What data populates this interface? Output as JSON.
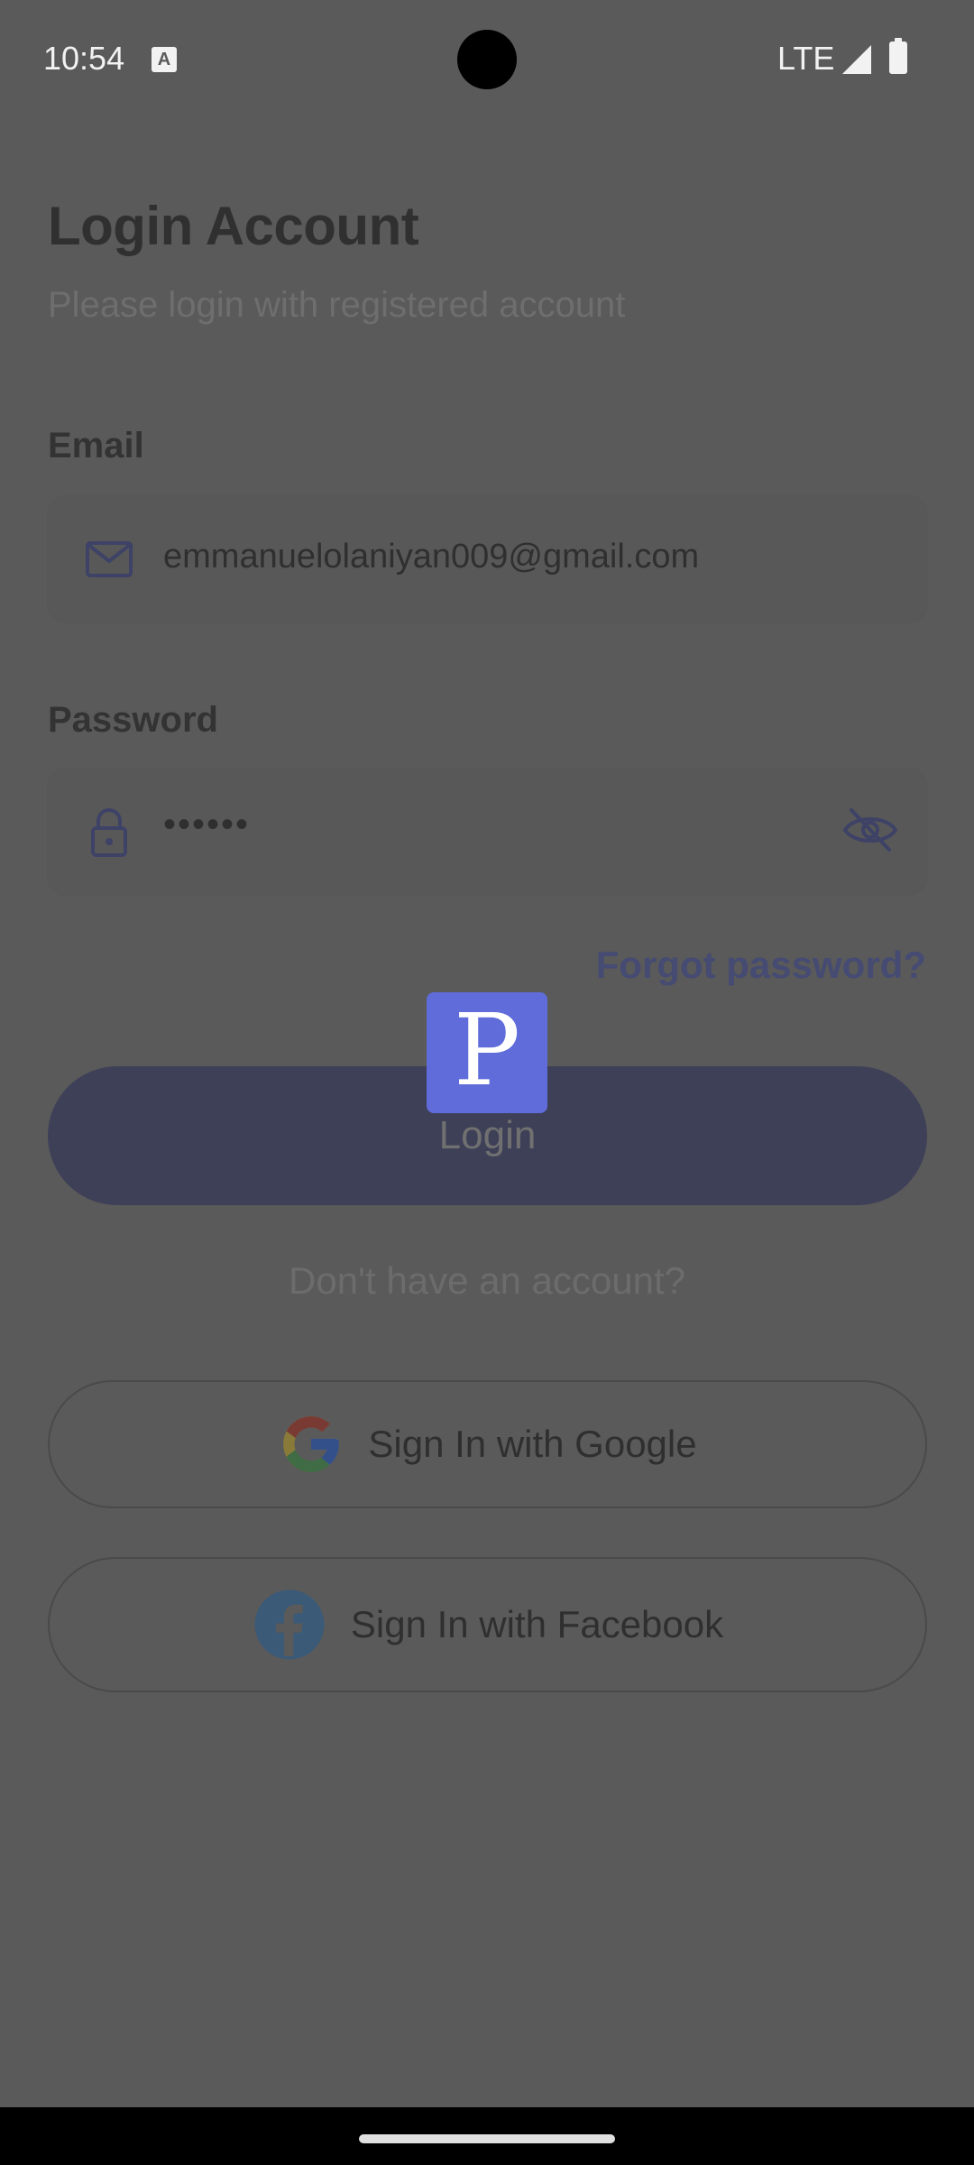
{
  "status_bar": {
    "time": "10:54",
    "network": "LTE",
    "icons": [
      "notification-a-icon",
      "signal-icon",
      "battery-icon"
    ]
  },
  "header": {
    "title": "Login Account",
    "subtitle": "Please login with registered account"
  },
  "email": {
    "label": "Email",
    "value": "emmanuelolaniyan009@gmail.com",
    "icon": "mail-icon"
  },
  "password": {
    "label": "Password",
    "value": "••••••",
    "icon": "lock-icon",
    "toggle_icon": "eye-off-icon"
  },
  "forgot_password": "Forgot password?",
  "login_button": "Login",
  "overlay_badge": {
    "letter": "P",
    "color": "#5f6cd9"
  },
  "no_account": "Don't have an account?",
  "social": {
    "google": "Sign In with Google",
    "facebook": "Sign In with Facebook"
  },
  "colors": {
    "background_dimmed": "#5a5a5a",
    "accent": "#454b72",
    "login_button": "#3e4058"
  }
}
